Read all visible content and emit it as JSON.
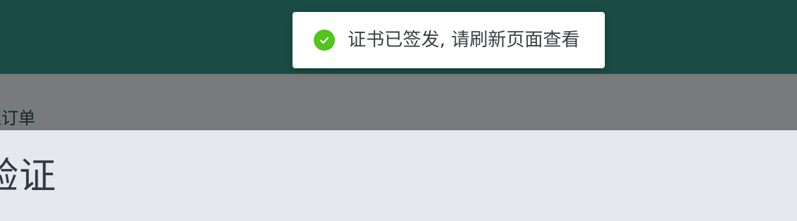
{
  "toast": {
    "message": "证书已签发, 请刷新页面查看",
    "icon": "check-circle-icon",
    "icon_color": "#52c41a"
  },
  "breadcrumb": {
    "current": "理订单"
  },
  "page": {
    "title": "验证"
  },
  "colors": {
    "topbar": "#1a4b45",
    "page_background": "#e5e9ed"
  }
}
